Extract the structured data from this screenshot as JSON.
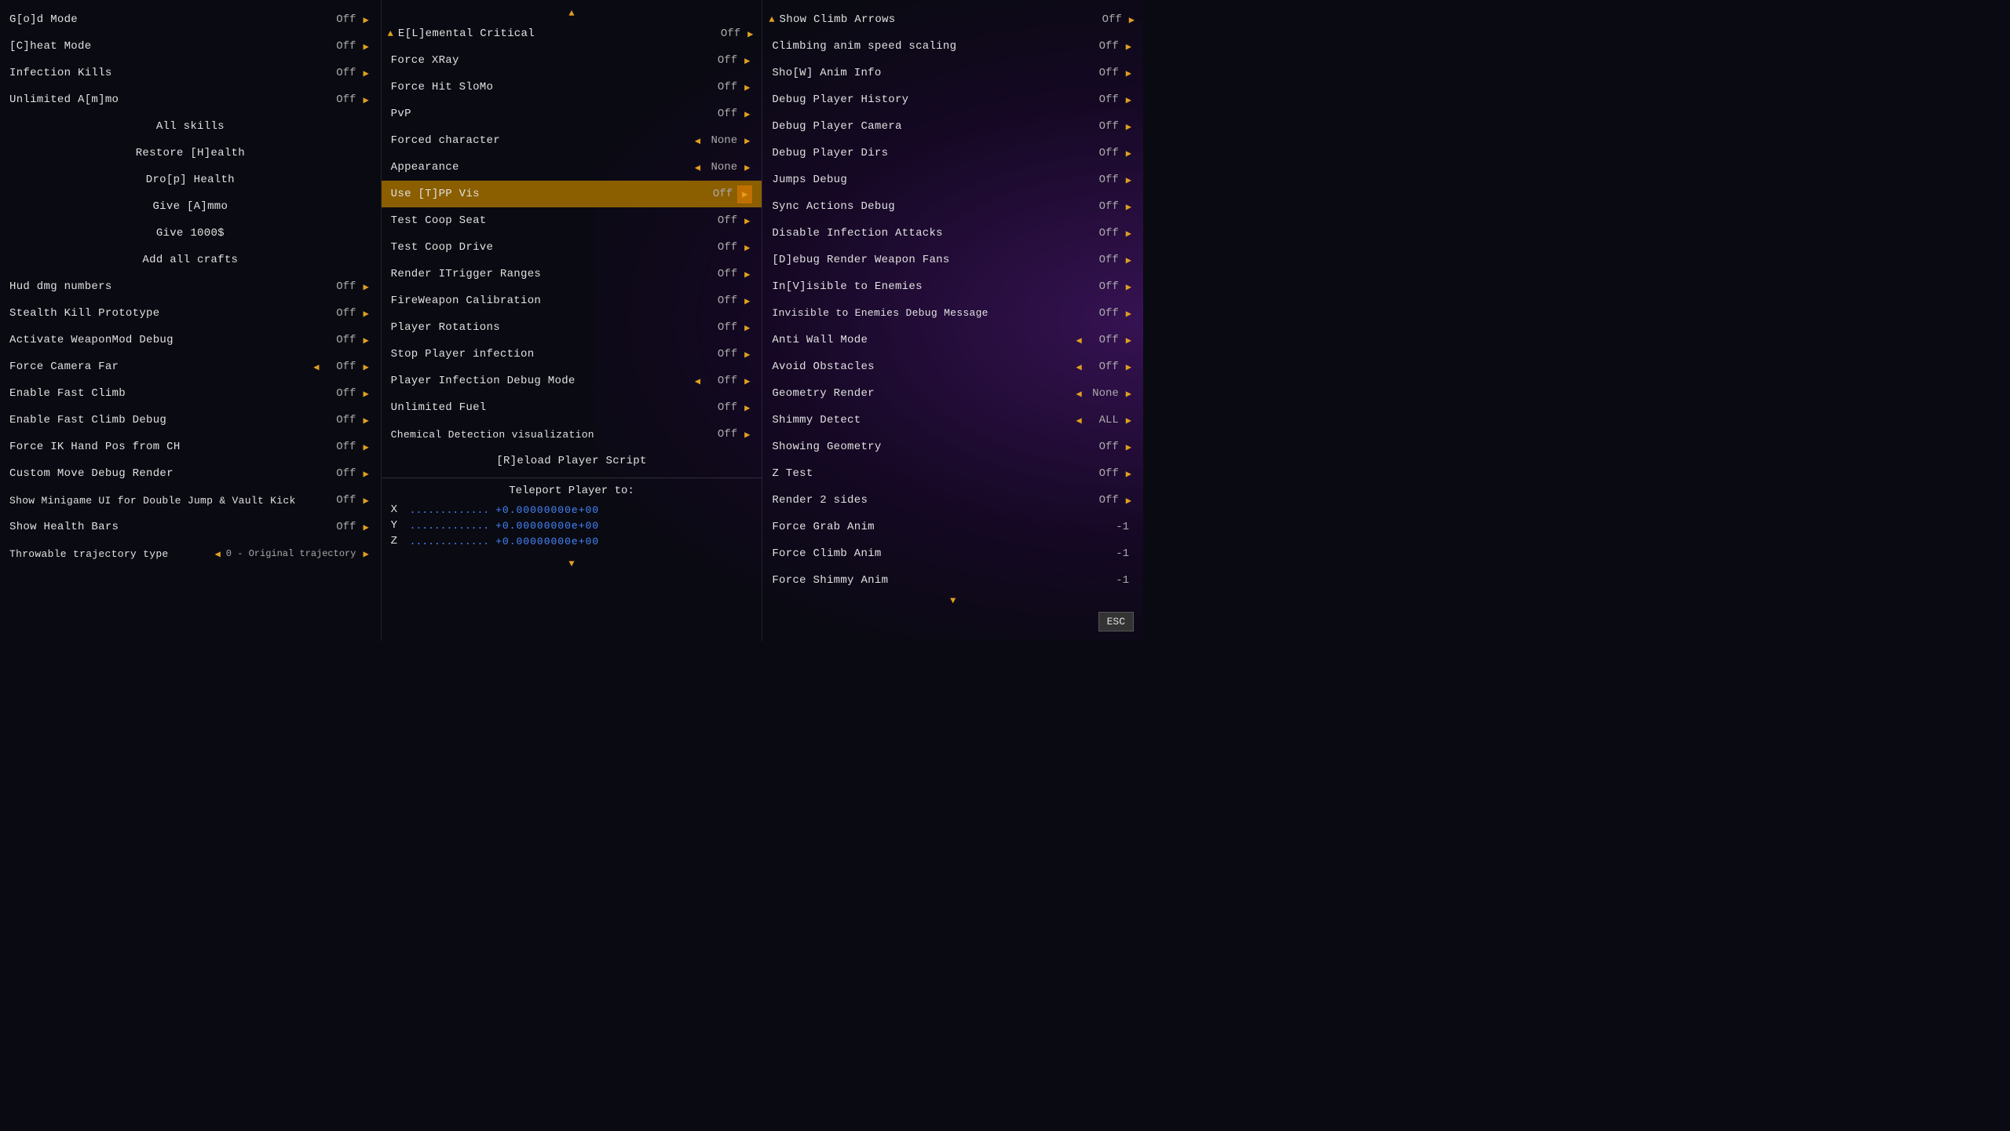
{
  "columns": [
    {
      "id": "col1",
      "items": [
        {
          "type": "item",
          "label": "G[o]d Mode",
          "value": "Off",
          "hasLeftArrow": false,
          "hasRightArrow": true
        },
        {
          "type": "item",
          "label": "[C]heat Mode",
          "value": "Off",
          "hasLeftArrow": false,
          "hasRightArrow": true
        },
        {
          "type": "item",
          "label": "Infection Kills",
          "value": "Off",
          "hasLeftArrow": false,
          "hasRightArrow": true
        },
        {
          "type": "item",
          "label": "Unlimited A[m]mo",
          "value": "Off",
          "hasLeftArrow": false,
          "hasRightArrow": true
        },
        {
          "type": "action",
          "label": "All skills"
        },
        {
          "type": "action",
          "label": "Restore [H]ealth"
        },
        {
          "type": "action",
          "label": "Dro[p] Health"
        },
        {
          "type": "action",
          "label": "Give [A]mmo"
        },
        {
          "type": "action",
          "label": "Give 1000$"
        },
        {
          "type": "action",
          "label": "Add all crafts"
        },
        {
          "type": "item",
          "label": "Hud dmg numbers",
          "value": "Off",
          "hasLeftArrow": false,
          "hasRightArrow": true
        },
        {
          "type": "item",
          "label": "Stealth Kill Prototype",
          "value": "Off",
          "hasLeftArrow": false,
          "hasRightArrow": true
        },
        {
          "type": "item",
          "label": "Activate WeaponMod Debug",
          "value": "Off",
          "hasLeftArrow": false,
          "hasRightArrow": true
        },
        {
          "type": "item",
          "label": "Force Camera Far",
          "value": "Off",
          "hasLeftArrow": true,
          "hasRightArrow": true
        },
        {
          "type": "item",
          "label": "Enable Fast Climb",
          "value": "Off",
          "hasLeftArrow": false,
          "hasRightArrow": true
        },
        {
          "type": "item",
          "label": "Enable Fast Climb Debug",
          "value": "Off",
          "hasLeftArrow": false,
          "hasRightArrow": true
        },
        {
          "type": "item",
          "label": "Force IK Hand Pos from CH",
          "value": "Off",
          "hasLeftArrow": false,
          "hasRightArrow": true
        },
        {
          "type": "item",
          "label": "Custom Move Debug Render",
          "value": "Off",
          "hasLeftArrow": false,
          "hasRightArrow": true
        },
        {
          "type": "item",
          "label": "Show Minigame UI for Double Jump & Vault Kick",
          "value": "Off",
          "hasLeftArrow": false,
          "hasRightArrow": true
        },
        {
          "type": "item",
          "label": "Show Health Bars",
          "value": "Off",
          "hasLeftArrow": false,
          "hasRightArrow": true
        },
        {
          "type": "item",
          "label": "Throwable trajectory type",
          "value": "0 - Original trajectory",
          "hasLeftArrow": true,
          "hasRightArrow": true
        }
      ]
    },
    {
      "id": "col2",
      "header": "E[L]emental Critical",
      "headerValue": "Off",
      "items": [
        {
          "type": "item",
          "label": "Force XRay",
          "value": "Off",
          "hasLeftArrow": false,
          "hasRightArrow": true
        },
        {
          "type": "item",
          "label": "Force Hit SloMo",
          "value": "Off",
          "hasLeftArrow": false,
          "hasRightArrow": true
        },
        {
          "type": "item",
          "label": "PvP",
          "value": "Off",
          "hasLeftArrow": false,
          "hasRightArrow": true
        },
        {
          "type": "item",
          "label": "Forced character",
          "value": "None",
          "hasLeftArrow": true,
          "hasRightArrow": true
        },
        {
          "type": "item",
          "label": "Appearance",
          "value": "None",
          "hasLeftArrow": true,
          "hasRightArrow": true
        },
        {
          "type": "item",
          "label": "Use [T]PP Vis",
          "value": "Off",
          "hasLeftArrow": false,
          "hasRightArrow": true,
          "highlighted": true
        },
        {
          "type": "item",
          "label": "Test Coop Seat",
          "value": "Off",
          "hasLeftArrow": false,
          "hasRightArrow": true
        },
        {
          "type": "item",
          "label": "Test Coop Drive",
          "value": "Off",
          "hasLeftArrow": false,
          "hasRightArrow": true
        },
        {
          "type": "item",
          "label": "Render ITrigger Ranges",
          "value": "Off",
          "hasLeftArrow": false,
          "hasRightArrow": true
        },
        {
          "type": "item",
          "label": "FireWeapon Calibration",
          "value": "Off",
          "hasLeftArrow": false,
          "hasRightArrow": true
        },
        {
          "type": "item",
          "label": "Player Rotations",
          "value": "Off",
          "hasLeftArrow": false,
          "hasRightArrow": true
        },
        {
          "type": "item",
          "label": "Stop Player infection",
          "value": "Off",
          "hasLeftArrow": false,
          "hasRightArrow": true
        },
        {
          "type": "item",
          "label": "Player Infection Debug Mode",
          "value": "Off",
          "hasLeftArrow": true,
          "hasRightArrow": true
        },
        {
          "type": "item",
          "label": "Unlimited Fuel",
          "value": "Off",
          "hasLeftArrow": false,
          "hasRightArrow": true
        },
        {
          "type": "item",
          "label": "Chemical Detection visualization",
          "value": "Off",
          "hasLeftArrow": false,
          "hasRightArrow": true
        },
        {
          "type": "action",
          "label": "[R]eload Player Script"
        },
        {
          "type": "teleport"
        }
      ]
    },
    {
      "id": "col3",
      "header": "Show Climb Arrows",
      "headerValue": "Off",
      "items": [
        {
          "type": "item",
          "label": "Climbing anim speed scaling",
          "value": "Off",
          "hasLeftArrow": false,
          "hasRightArrow": true
        },
        {
          "type": "item",
          "label": "Sho[W] Anim Info",
          "value": "Off",
          "hasLeftArrow": false,
          "hasRightArrow": true
        },
        {
          "type": "item",
          "label": "Debug Player History",
          "value": "Off",
          "hasLeftArrow": false,
          "hasRightArrow": true
        },
        {
          "type": "item",
          "label": "Debug Player Camera",
          "value": "Off",
          "hasLeftArrow": false,
          "hasRightArrow": true
        },
        {
          "type": "item",
          "label": "Debug Player Dirs",
          "value": "Off",
          "hasLeftArrow": false,
          "hasRightArrow": true
        },
        {
          "type": "item",
          "label": "Jumps Debug",
          "value": "Off",
          "hasLeftArrow": false,
          "hasRightArrow": true
        },
        {
          "type": "item",
          "label": "Sync Actions Debug",
          "value": "Off",
          "hasLeftArrow": false,
          "hasRightArrow": true
        },
        {
          "type": "item",
          "label": "Disable Infection Attacks",
          "value": "Off",
          "hasLeftArrow": false,
          "hasRightArrow": true
        },
        {
          "type": "item",
          "label": "[D]ebug Render Weapon Fans",
          "value": "Off",
          "hasLeftArrow": false,
          "hasRightArrow": true
        },
        {
          "type": "item",
          "label": "In[V]isible to Enemies",
          "value": "Off",
          "hasLeftArrow": false,
          "hasRightArrow": true
        },
        {
          "type": "item",
          "label": "Invisible to Enemies Debug Message",
          "value": "Off",
          "hasLeftArrow": false,
          "hasRightArrow": true
        },
        {
          "type": "item",
          "label": "Anti Wall Mode",
          "value": "Off",
          "hasLeftArrow": true,
          "hasRightArrow": true
        },
        {
          "type": "item",
          "label": "Avoid Obstacles",
          "value": "Off",
          "hasLeftArrow": true,
          "hasRightArrow": true
        },
        {
          "type": "item",
          "label": "Geometry Render",
          "value": "None",
          "hasLeftArrow": true,
          "hasRightArrow": true
        },
        {
          "type": "item",
          "label": "Shimmy Detect",
          "value": "ALL",
          "hasLeftArrow": true,
          "hasRightArrow": true
        },
        {
          "type": "item",
          "label": "Showing Geometry",
          "value": "Off",
          "hasLeftArrow": false,
          "hasRightArrow": true
        },
        {
          "type": "item",
          "label": "Z Test",
          "value": "Off",
          "hasLeftArrow": false,
          "hasRightArrow": true
        },
        {
          "type": "item",
          "label": "Render 2 sides",
          "value": "Off",
          "hasLeftArrow": false,
          "hasRightArrow": true
        },
        {
          "type": "item",
          "label": "Force Grab Anim",
          "value": "-1",
          "hasLeftArrow": false,
          "hasRightArrow": false
        },
        {
          "type": "item",
          "label": "Force Climb Anim",
          "value": "-1",
          "hasLeftArrow": false,
          "hasRightArrow": false
        },
        {
          "type": "item",
          "label": "Force Shimmy Anim",
          "value": "-1",
          "hasLeftArrow": false,
          "hasRightArrow": false
        }
      ]
    }
  ],
  "teleport": {
    "title": "Teleport Player to:",
    "x_label": "X",
    "y_label": "Y",
    "z_label": "Z",
    "x_value": "+0.00000000e+00",
    "y_value": "+0.00000000e+00",
    "z_value": "+0.00000000e+00"
  },
  "esc_label": "ESC",
  "icons": {
    "right_arrow": "▶",
    "left_arrow": "◀",
    "up_arrow": "▲",
    "down_arrow": "▼"
  }
}
